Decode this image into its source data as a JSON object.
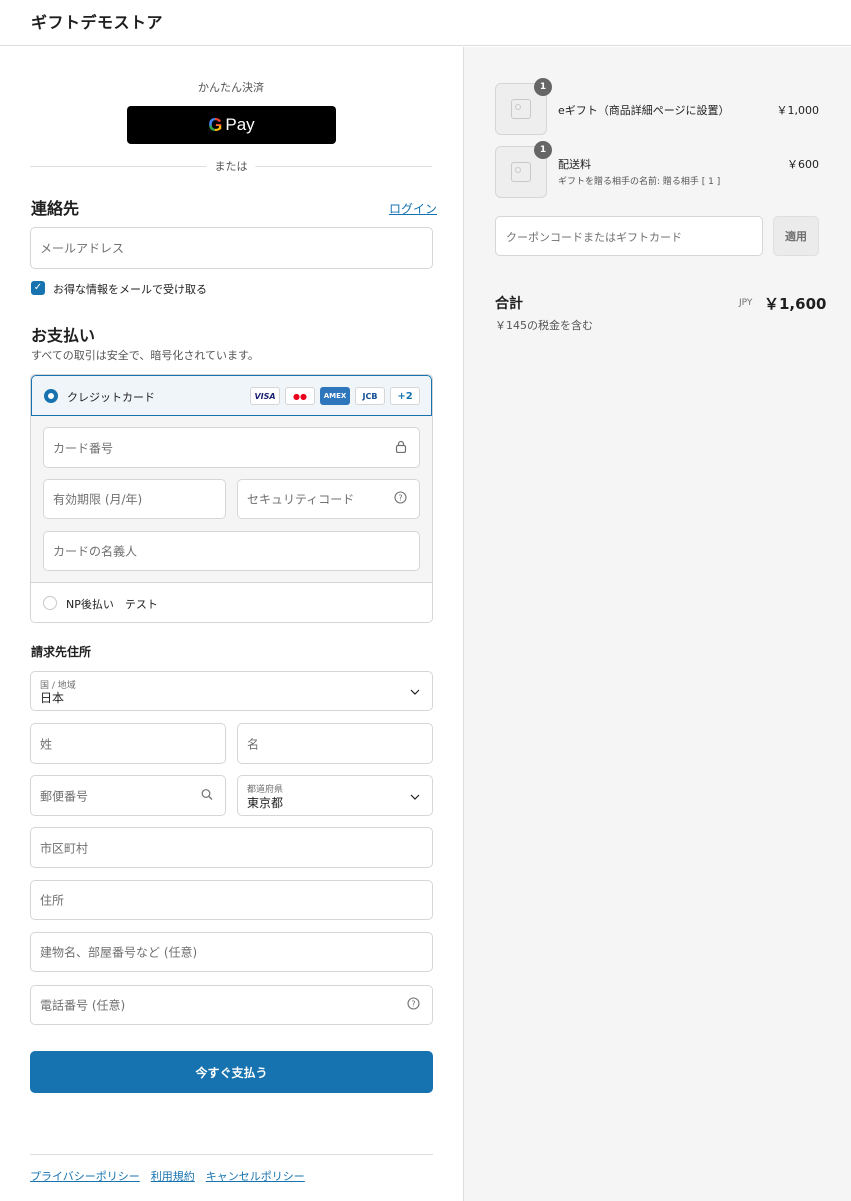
{
  "header": {
    "store_name": "ギフトデモストア"
  },
  "express": {
    "label": "かんたん決済",
    "gpay_g": "G",
    "gpay_label": "Pay",
    "or": "または"
  },
  "contact": {
    "title": "連絡先",
    "login": "ログイン",
    "email_placeholder": "メールアドレス",
    "marketing_checkbox": "お得な情報をメールで受け取る",
    "checked_mark": "✓"
  },
  "payment": {
    "title": "お支払い",
    "subtitle": "すべての取引は安全で、暗号化されています。",
    "credit_card_label": "クレジットカード",
    "card_brands": [
      "VISA",
      "●●",
      "AMEX",
      "JCB",
      "+2"
    ],
    "card_number_placeholder": "カード番号",
    "expiry_placeholder": "有効期限 (月/年)",
    "security_placeholder": "セキュリティコード",
    "name_on_card_placeholder": "カードの名義人",
    "np_label": "NP後払い　テスト"
  },
  "billing": {
    "title": "請求先住所",
    "country_label": "国 / 地域",
    "country_value": "日本",
    "last_name": "姓",
    "first_name": "名",
    "postal_code": "郵便番号",
    "prefecture_label": "都道府県",
    "prefecture_value": "東京都",
    "city": "市区町村",
    "address": "住所",
    "building": "建物名、部屋番号など (任意)",
    "phone": "電話番号 (任意)"
  },
  "pay_now": "今すぐ支払う",
  "footer": {
    "links": [
      "プライバシーポリシー",
      "利用規約",
      "キャンセルポリシー"
    ]
  },
  "summary": {
    "items": [
      {
        "name": "eギフト（商品詳細ページに設置）",
        "sub": "",
        "price": "￥1,000",
        "qty": "1"
      },
      {
        "name": "配送料",
        "sub": "ギフトを贈る相手の名前: 贈る相手 [ 1 ]",
        "price": "￥600",
        "qty": "1"
      }
    ],
    "coupon_placeholder": "クーポンコードまたはギフトカード",
    "apply": "適用",
    "total_label": "合計",
    "currency": "JPY",
    "total": "￥1,600",
    "tax_note": "￥145の税金を含む"
  },
  "icons": {
    "lock": "🔒",
    "help": "?",
    "chevron": "⌄",
    "search": "⌕"
  },
  "colors": {
    "accent": "#1773b0",
    "right_panel": "#f5f5f5"
  }
}
